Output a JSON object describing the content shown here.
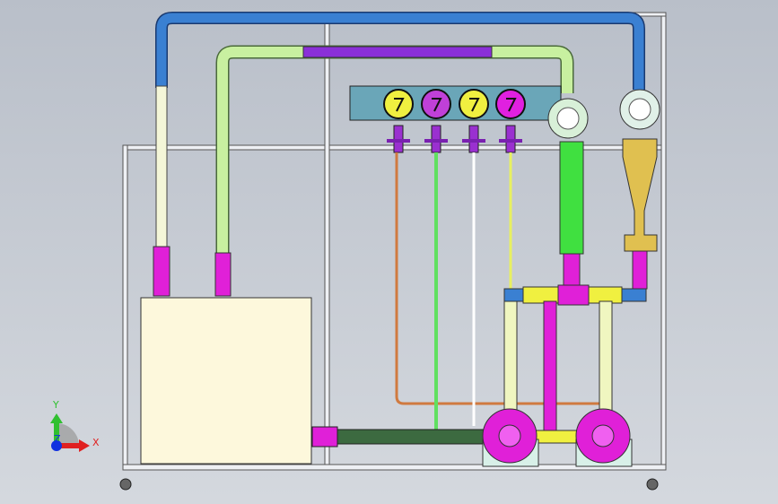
{
  "viewport": {
    "background_top": "#b9bfc9",
    "background_bottom": "#d4d8de"
  },
  "triad": {
    "x_label": "X",
    "y_label": "Y",
    "z_label": "Z",
    "x_color": "#e02020",
    "y_color": "#30c030",
    "z_color": "#1030e0"
  },
  "colors": {
    "frame": "#eef0f4",
    "blue_pipe": "#3a80d2",
    "green_pipe": "#c8f0a0",
    "purple_section": "#8a30d8",
    "cream_pipe": "#f4f6d8",
    "magenta": "#e020d8",
    "tank": "#fdf8dc",
    "panel": "#6aa6b8",
    "yellow": "#f0f040",
    "dark_green_pipe": "#3c6a40",
    "orange_tube": "#d07a40",
    "gold": "#e0c050",
    "bright_green": "#40e040"
  },
  "gauges": [
    {
      "color": "#f0f040"
    },
    {
      "color": "#c040d8"
    },
    {
      "color": "#f0f040"
    },
    {
      "color": "#e020e0"
    }
  ]
}
